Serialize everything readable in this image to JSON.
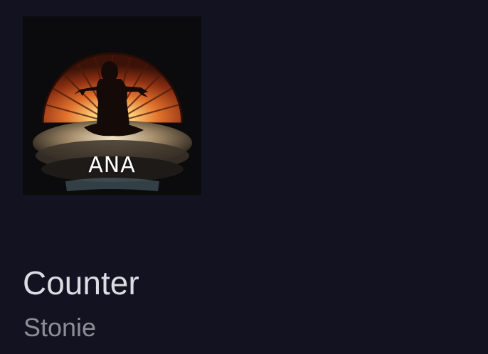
{
  "now_playing": {
    "album_art": {
      "title_text": "ANA",
      "colors": {
        "glow_center": "#ffd07a",
        "glow_mid": "#e0702c",
        "glow_edge": "#3a1208",
        "background": "#0b0a0c",
        "silhouette": "#140a08"
      }
    },
    "title": "Counter",
    "artist": "Stonie"
  },
  "theme": {
    "background": "#121221",
    "title_color": "#dcdce3",
    "artist_color": "#8d8d95"
  }
}
